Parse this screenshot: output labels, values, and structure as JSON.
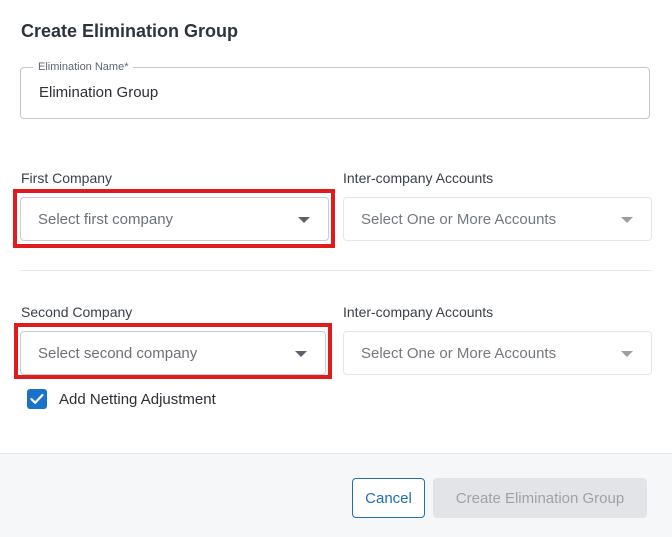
{
  "dialog": {
    "title": "Create Elimination Group"
  },
  "elimination_name": {
    "label": "Elimination Name*",
    "value": "Elimination Group"
  },
  "first_company": {
    "label": "First Company",
    "placeholder": "Select first company"
  },
  "first_accounts": {
    "label": "Inter-company Accounts",
    "placeholder": "Select One or More Accounts"
  },
  "second_company": {
    "label": "Second Company",
    "placeholder": "Select second company"
  },
  "second_accounts": {
    "label": "Inter-company Accounts",
    "placeholder": "Select One or More Accounts"
  },
  "netting": {
    "label": "Add Netting Adjustment",
    "checked": true
  },
  "footer": {
    "cancel_label": "Cancel",
    "create_label": "Create Elimination Group"
  },
  "colors": {
    "accent": "#1a73c8",
    "highlight": "#e01b1b",
    "disabled_bg": "#e2e4e7"
  },
  "icons": {
    "dropdown": "caret-down-icon",
    "check": "checkmark-icon"
  }
}
